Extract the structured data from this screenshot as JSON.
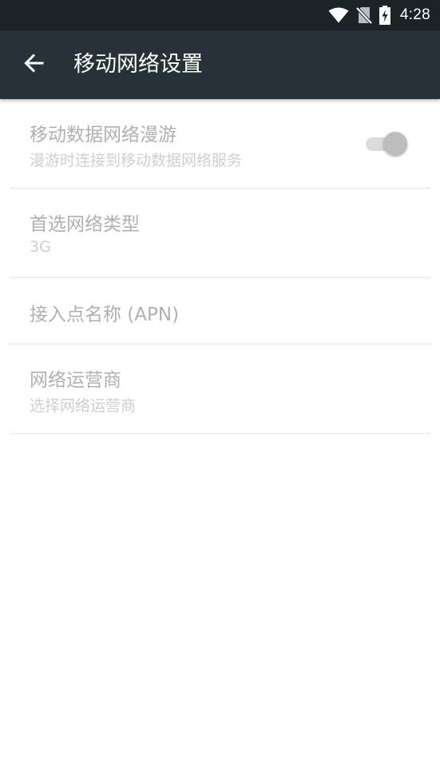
{
  "status_bar": {
    "time": "4:28",
    "icons": [
      "wifi-icon",
      "no-sim-icon",
      "battery-charging-icon"
    ]
  },
  "toolbar": {
    "back_icon": "arrow-back-icon",
    "title": "移动网络设置"
  },
  "settings": {
    "items": [
      {
        "title": "移动数据网络漫游",
        "summary": "漫游时连接到移动数据网络服务",
        "control": "switch",
        "enabled": false
      },
      {
        "title": "首选网络类型",
        "summary": "3G",
        "enabled": false
      },
      {
        "title": "接入点名称 (APN)",
        "enabled": false
      },
      {
        "title": "网络运营商",
        "summary": "选择网络运营商",
        "enabled": false
      }
    ]
  },
  "colors": {
    "status_bar_bg": "#1c2327",
    "toolbar_bg": "#263238",
    "disabled_title": "#b0b0b0",
    "disabled_summary": "#cfcfcf",
    "divider": "#e3e3e3"
  }
}
